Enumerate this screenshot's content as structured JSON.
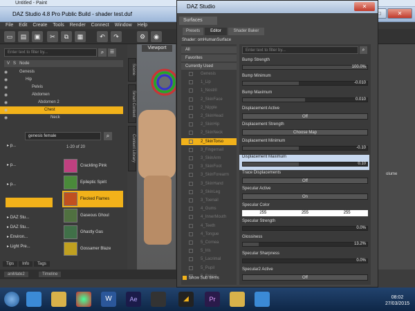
{
  "paint_title": "Untitled - Paint",
  "daz_title": "DAZ Studio 4.8 Pro Public Build - shader test.duf",
  "menu": [
    "File",
    "Edit",
    "Create",
    "Tools",
    "Render",
    "Connect",
    "Window",
    "Help"
  ],
  "scene": {
    "filter_placeholder": "Enter text to filter by...",
    "col_v": "V",
    "col_s": "S",
    "col_node": "Node",
    "nodes": [
      {
        "label": "Genesis",
        "level": 0
      },
      {
        "label": "Hip",
        "level": 1
      },
      {
        "label": "Pelvis",
        "level": 2
      },
      {
        "label": "Abdomen",
        "level": 2
      },
      {
        "label": "Abdomen 2",
        "level": 3
      },
      {
        "label": "Chest",
        "level": 4,
        "selected": true
      },
      {
        "label": "Neck",
        "level": 5
      }
    ]
  },
  "library": {
    "search": "genesis female",
    "paging": "1-20 of 20",
    "folders": [
      "p...",
      "p...",
      "p...",
      "DAZ Stu...",
      "DAZ Stu...",
      "Environ...",
      "Light Pre..."
    ],
    "items": [
      {
        "label": "Crackling Pink",
        "color": "#c04080"
      },
      {
        "label": "Epileptic Spirit",
        "color": "#4a8a3a"
      },
      {
        "label": "Flecked Flames",
        "color": "#c05020",
        "selected": true
      },
      {
        "label": "Gaseous Ghoul",
        "color": "#507040"
      },
      {
        "label": "Ghastly Gas",
        "color": "#407048"
      },
      {
        "label": "Gossamer Blaze",
        "color": "#c0a020"
      }
    ]
  },
  "side_tabs": {
    "scene": "Scene",
    "smart": "Smart Content",
    "content": "Content Library"
  },
  "bottom_tabs": [
    "Tips",
    "Info",
    "Tags"
  ],
  "lower_tabs": [
    "aniMate2",
    "Timeline"
  ],
  "viewport_tab": "Viewport",
  "right_labels": {
    "volume": "olume"
  },
  "dialog": {
    "title": "DAZ Studio",
    "surfaces_tab": "Surfaces",
    "subtabs": [
      "Presets",
      "Editor",
      "Shader Baker"
    ],
    "shader": "Shader: omHumanSurface",
    "filter_placeholder": "Enter text to filter by...",
    "groups": [
      {
        "label": "All",
        "cls": ""
      },
      {
        "label": "Favorites",
        "cls": ""
      },
      {
        "label": "Currently Used",
        "cls": ""
      },
      {
        "label": "Genesis",
        "cls": "dim root"
      },
      {
        "label": "1_Lip",
        "cls": "dim"
      },
      {
        "label": "1_Nostril",
        "cls": "dim"
      },
      {
        "label": "2_SkinFace",
        "cls": "dim"
      },
      {
        "label": "2_Nipple",
        "cls": "dim"
      },
      {
        "label": "2_SkinHead",
        "cls": "dim"
      },
      {
        "label": "2_SkinHip",
        "cls": "dim"
      },
      {
        "label": "2_SkinNeck",
        "cls": "dim"
      },
      {
        "label": "2_SkinTorso",
        "cls": "sel"
      },
      {
        "label": "3_Fingernail",
        "cls": "dim"
      },
      {
        "label": "3_SkinArm",
        "cls": "dim"
      },
      {
        "label": "3_SkinFoot",
        "cls": "dim"
      },
      {
        "label": "3_SkinForearm",
        "cls": "dim"
      },
      {
        "label": "3_SkinHand",
        "cls": "dim"
      },
      {
        "label": "3_SkinLeg",
        "cls": "dim"
      },
      {
        "label": "3_Toenail",
        "cls": "dim"
      },
      {
        "label": "4_Gums",
        "cls": "dim"
      },
      {
        "label": "4_InnerMouth",
        "cls": "dim"
      },
      {
        "label": "4_Teeth",
        "cls": "dim"
      },
      {
        "label": "4_Tongue",
        "cls": "dim"
      },
      {
        "label": "5_Cornea",
        "cls": "dim"
      },
      {
        "label": "5_Iris",
        "cls": "dim"
      },
      {
        "label": "5_Lacrimal",
        "cls": "dim"
      },
      {
        "label": "5_Pupil",
        "cls": "dim"
      },
      {
        "label": "5_Sclera",
        "cls": "dim"
      }
    ],
    "show_sub": "Show Sub Items",
    "props": [
      {
        "name": "Bump Strength",
        "type": "slider",
        "value": "100.0%",
        "fill": 1.0
      },
      {
        "name": "Bump Minimum",
        "type": "slider",
        "value": "-0.010",
        "fill": 0.45
      },
      {
        "name": "Bump Maximum",
        "type": "slider",
        "value": "0.010",
        "fill": 0.5
      },
      {
        "name": "Displacement Active",
        "type": "button",
        "value": "Off"
      },
      {
        "name": "Displacement Strength",
        "type": "button",
        "value": "Choose Map"
      },
      {
        "name": "Displacement Minimum",
        "type": "slider",
        "value": "-0.10",
        "fill": 0.45
      },
      {
        "name": "Displacement Maximum",
        "type": "slider",
        "value": "0.10",
        "fill": 0.45,
        "selected": true
      },
      {
        "name": "Trace Displacements",
        "type": "button",
        "value": "Off"
      },
      {
        "name": "Specular Active",
        "type": "button",
        "value": "On"
      },
      {
        "name": "Specular Color",
        "type": "color",
        "value": [
          "255",
          "255",
          "255"
        ]
      },
      {
        "name": "Specular Strength",
        "type": "slider",
        "value": "0.0%",
        "fill": 0.0
      },
      {
        "name": "Glossiness",
        "type": "slider",
        "value": "13.2%",
        "fill": 0.13
      },
      {
        "name": "Specular Sharpness",
        "type": "slider",
        "value": "0.0%",
        "fill": 0.0
      },
      {
        "name": "Specular2 Active",
        "type": "button",
        "value": "Off"
      }
    ]
  },
  "clock": {
    "time": "08:02",
    "date": "27/03/2015"
  }
}
